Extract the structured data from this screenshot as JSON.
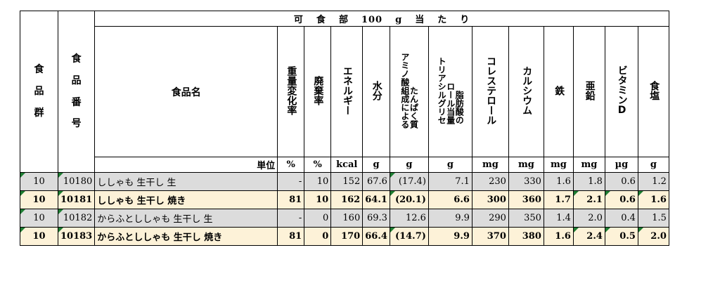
{
  "header": {
    "food_group": "食品群",
    "food_number": "食品番号",
    "food_name": "食品名",
    "title_chars": [
      "可",
      "食",
      "部",
      "100",
      "g",
      "当",
      "た",
      "り"
    ],
    "columns": [
      {
        "parts": [
          "重量変化率"
        ]
      },
      {
        "parts": [
          "廃棄率"
        ]
      },
      {
        "parts": [
          "エネルギー"
        ]
      },
      {
        "parts": [
          "水分"
        ]
      },
      {
        "parts": [
          "アミノ酸組成による",
          "たんぱく質"
        ]
      },
      {
        "parts": [
          "トリアシルグリセ",
          "ロール当量",
          "脂肪酸の"
        ]
      },
      {
        "parts": [
          "コレステロール"
        ]
      },
      {
        "parts": [
          "カルシウム"
        ]
      },
      {
        "parts": [
          "鉄"
        ]
      },
      {
        "parts": [
          "亜鉛"
        ]
      },
      {
        "parts": [
          "ビタミンD"
        ]
      },
      {
        "parts": [
          "食塩"
        ]
      }
    ]
  },
  "units": {
    "label": "単位",
    "values": [
      "%",
      "%",
      "kcal",
      "g",
      "g",
      "g",
      "mg",
      "mg",
      "mg",
      "mg",
      "µg",
      "g"
    ]
  },
  "rows": [
    {
      "group": "10",
      "number": "10180",
      "name": "ししゃも 生干し 生",
      "values": [
        "-",
        "10",
        "152",
        "67.6",
        "(17.4)",
        "7.1",
        "230",
        "330",
        "1.6",
        "1.8",
        "0.6",
        "1.2"
      ],
      "style": "gray"
    },
    {
      "group": "10",
      "number": "10181",
      "name": "ししゃも 生干し 焼き",
      "values": [
        "81",
        "10",
        "162",
        "64.1",
        "(20.1)",
        "6.6",
        "300",
        "360",
        "1.7",
        "2.1",
        "0.6",
        "1.6"
      ],
      "style": "cream"
    },
    {
      "group": "10",
      "number": "10182",
      "name": "からふとししゃも 生干し 生",
      "values": [
        "-",
        "0",
        "160",
        "69.3",
        "12.6",
        "9.9",
        "290",
        "350",
        "1.4",
        "2.0",
        "0.4",
        "1.5"
      ],
      "style": "gray"
    },
    {
      "group": "10",
      "number": "10183",
      "name": "からふとししゃも 生干し 焼き",
      "values": [
        "81",
        "0",
        "170",
        "66.4",
        "(14.7)",
        "9.9",
        "370",
        "380",
        "1.6",
        "2.4",
        "0.5",
        "2.0"
      ],
      "style": "cream"
    }
  ]
}
